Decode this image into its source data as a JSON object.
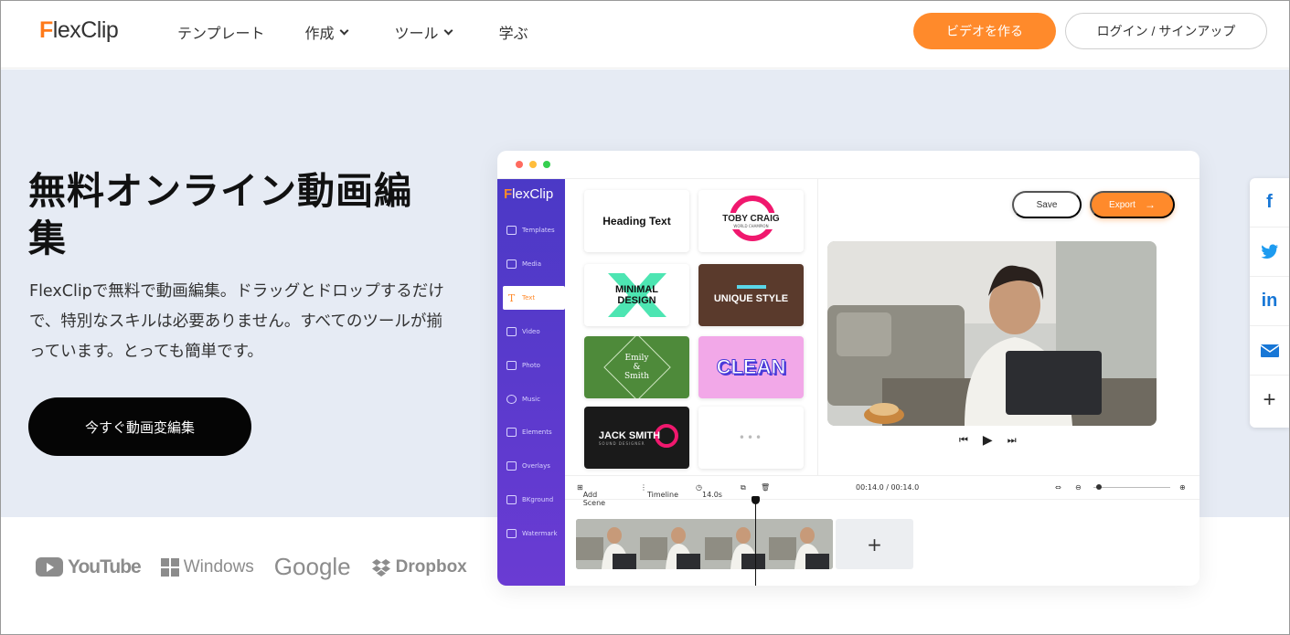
{
  "header": {
    "logo": "FlexClip",
    "nav": [
      "テンプレート",
      "作成",
      "ツール",
      "学ぶ"
    ],
    "create_button": "ビデオを作る",
    "login_button": "ログイン / サインアップ"
  },
  "hero": {
    "title": "無料オンライン動画編集",
    "description": "FlexClipで無料で動画編集。ドラッグとドロップするだけで、特別なスキルは必要ありません。すべてのツールが揃っています。とっても簡単です。",
    "cta": "今すぐ動画変編集"
  },
  "brands": [
    "YouTube",
    "Windows",
    "Google",
    "Dropbox"
  ],
  "editor": {
    "logo": "FlexClip",
    "sidebar": [
      "Templates",
      "Media",
      "Text",
      "Video",
      "Photo",
      "Music",
      "Elements",
      "Overlays",
      "BKground",
      "Watermark"
    ],
    "active_item": "Text",
    "templates": {
      "heading": "Heading Text",
      "toby_name": "TOBY CRAIG",
      "toby_sub": "WORLD CHAMPION",
      "minimal": "MINIMAL DESIGN",
      "unique": "UNIQUE STYLE",
      "emily_line1": "Emily",
      "emily_amp": "&",
      "emily_line2": "Smith",
      "clean": "CLEAN",
      "jack_name": "JACK SMITH",
      "jack_sub": "SOUND DESIGNER",
      "more": "•••"
    },
    "save": "Save",
    "export": "Export",
    "toolbar": {
      "add_scene": "Add Scene",
      "timeline": "Timeline",
      "duration": "14.0s",
      "time": "00:14.0 / 00:14.0"
    },
    "add_clip": "+"
  },
  "share": [
    "f",
    "twitter",
    "in",
    "mail",
    "+"
  ],
  "colors": {
    "accent": "#ff8a2b",
    "sidebar": "#5a3bd0",
    "hero_bg": "#e6ebf4"
  }
}
